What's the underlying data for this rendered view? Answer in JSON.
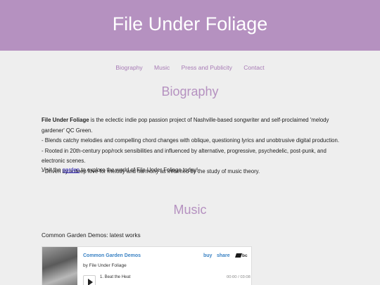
{
  "header": {
    "site_title": "File Under Foliage"
  },
  "nav": {
    "items": [
      "Biography",
      "Music",
      "Press and Publicity",
      "Contact"
    ]
  },
  "biography": {
    "heading": "Biography",
    "intro_bold": "File Under Foliage",
    "intro_rest": " is the eclectic indie pop passion project of Nashville-based songwriter and self-proclaimed 'melody gardener' QC Green.",
    "bullets": [
      "- Blends catchy melodies and compelling chord changes with oblique, questioning lyrics and unobtrusive digital production.",
      "- Rooted in 20th-century pop/rock sensibilities and influenced by alternative, progressive, psychedelic, post-punk, and electronic scenes.",
      "- Driven by a deep love for melody and harmony as informed by the study of music theory."
    ],
    "visit_before": "Visit the ",
    "visit_link": "garden",
    "visit_after": " to explore the world of File Under Foliage today!"
  },
  "music": {
    "heading": "Music",
    "subtitle": "Common Garden Demos: latest works",
    "player": {
      "album_title": "Common Garden Demos",
      "by_line": "by File Under Foliage",
      "buy_label": "buy",
      "share_label": "share",
      "bc_label": "bc",
      "track": "1.  Beat the Heat",
      "time": "00:00 / 03:08"
    }
  },
  "colors": {
    "header_bg": "#b591c0",
    "accent": "#a77bb5",
    "link": "#1a0dab",
    "player_link": "#3a82c4"
  }
}
